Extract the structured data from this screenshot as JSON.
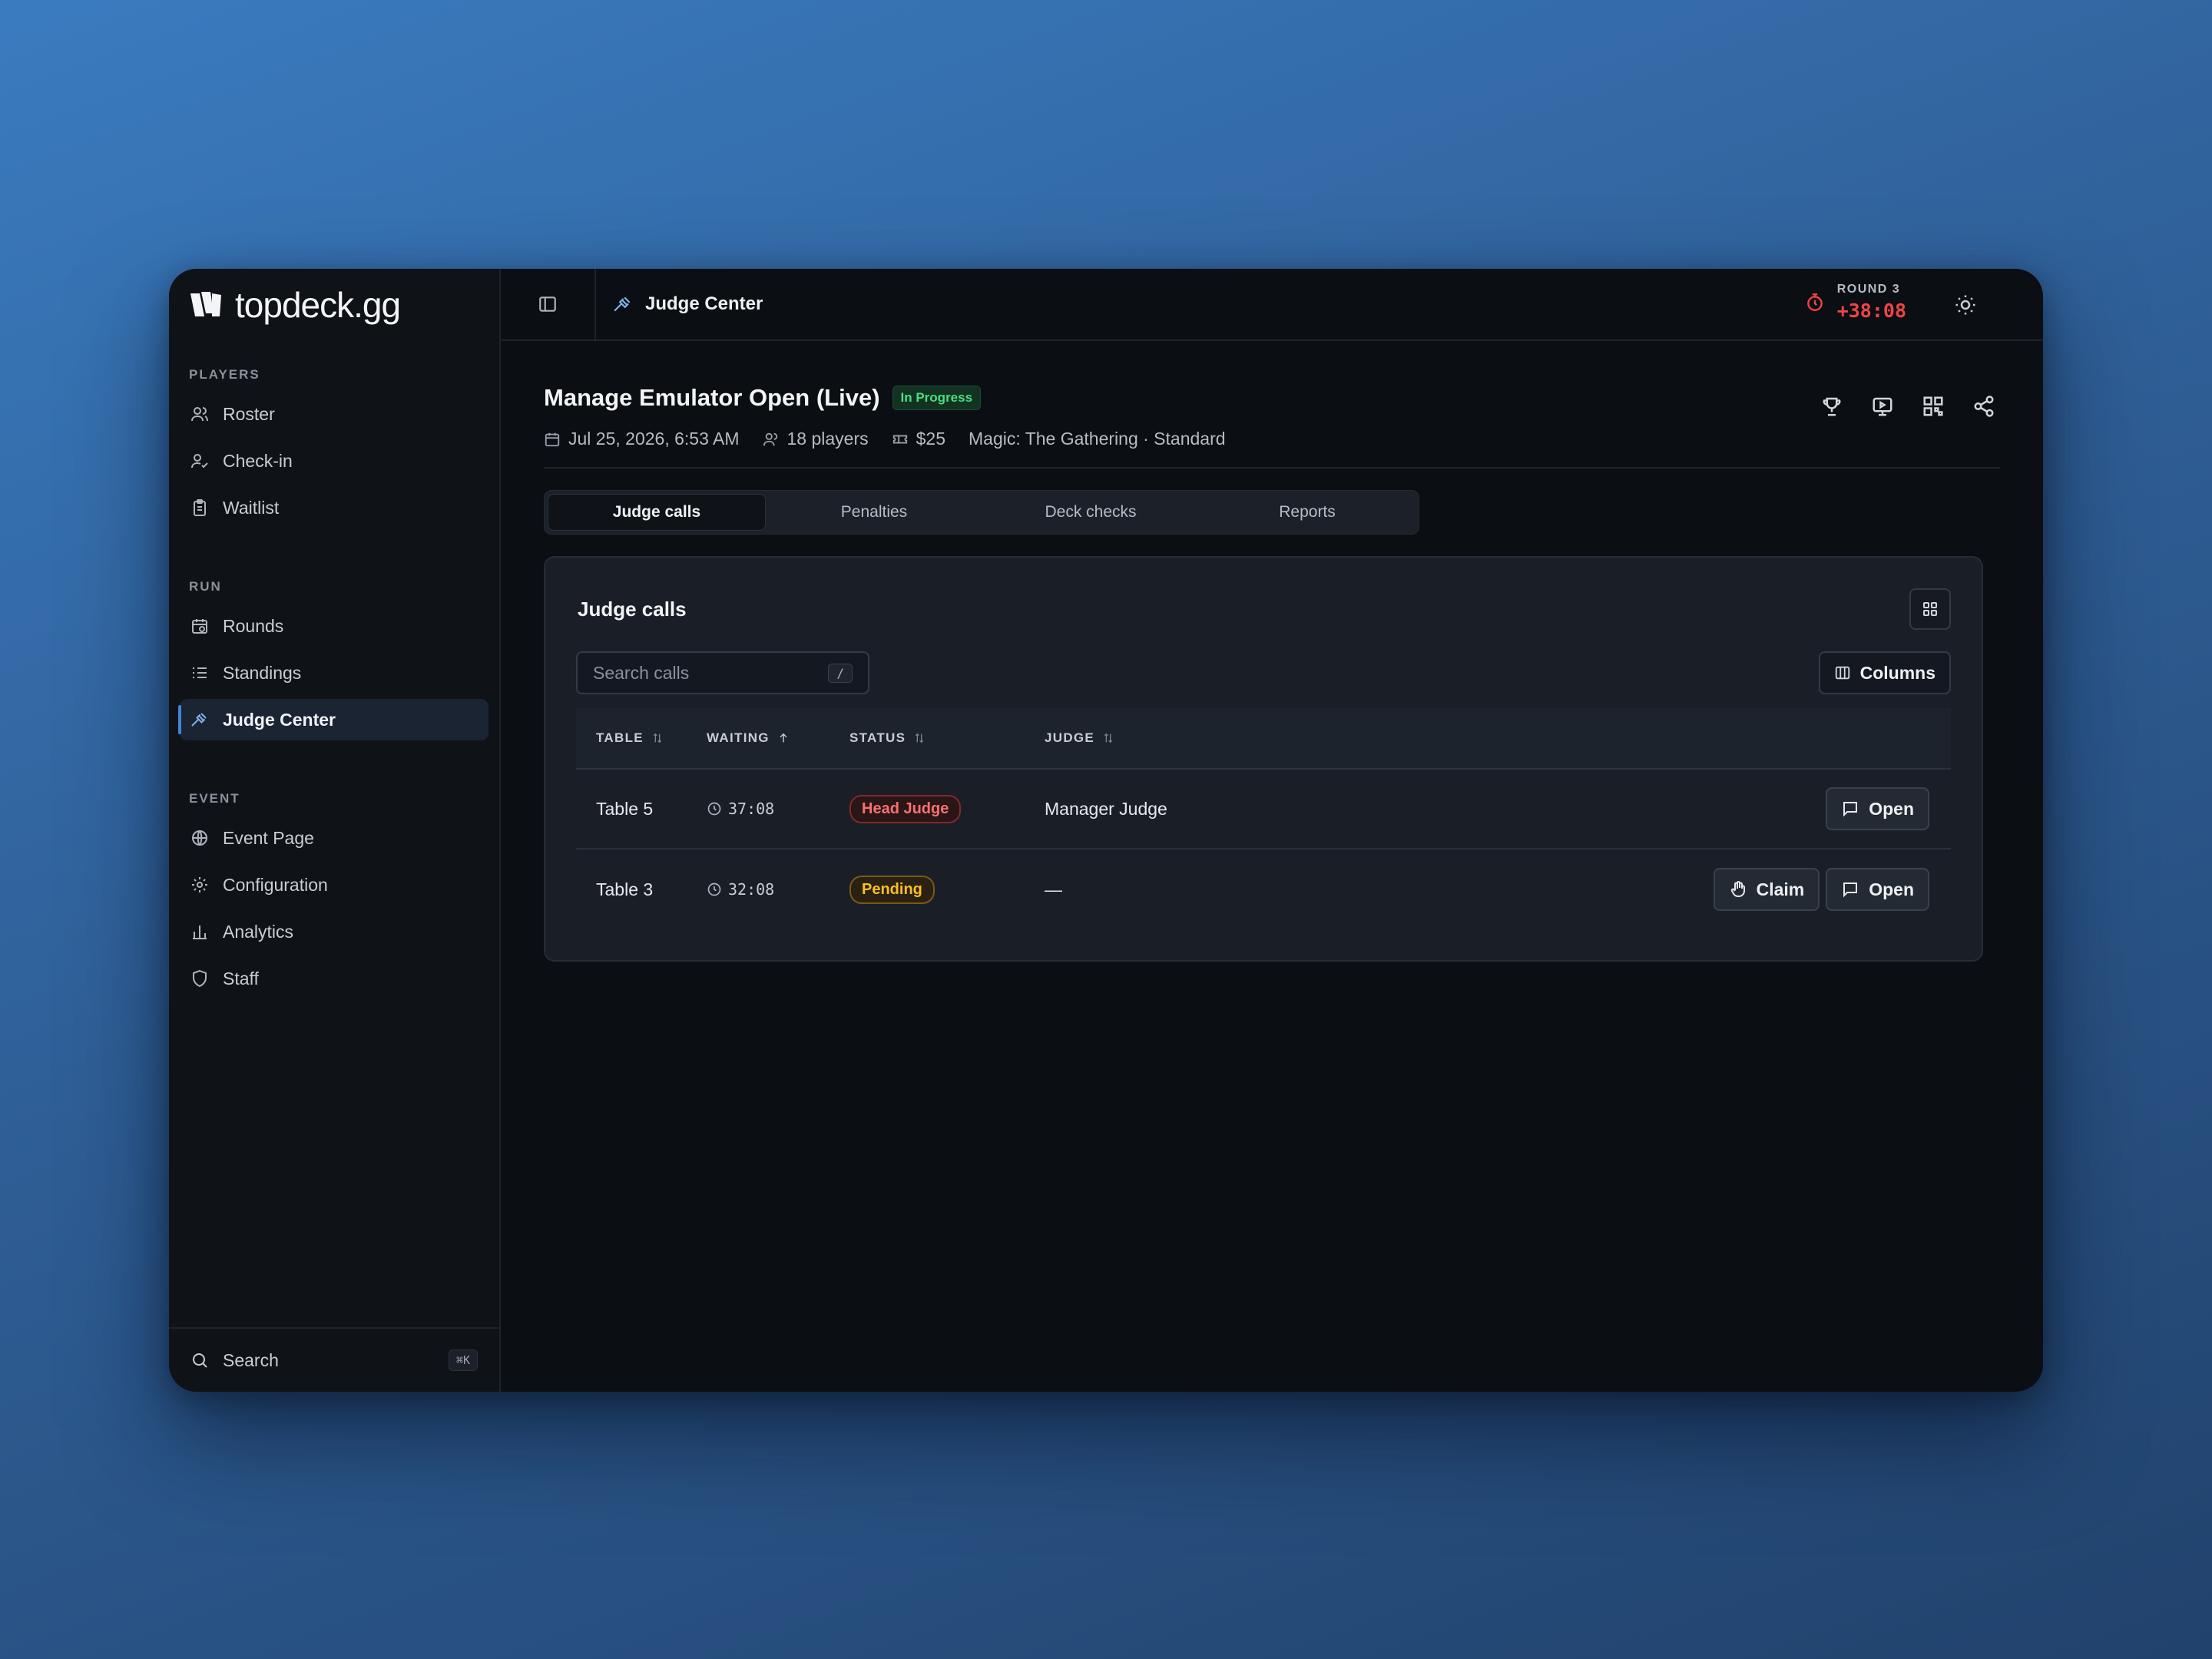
{
  "brand": {
    "name": "topdeck.gg"
  },
  "sidebar": {
    "sections": [
      {
        "label": "PLAYERS",
        "items": [
          {
            "label": "Roster",
            "icon": "users-icon"
          },
          {
            "label": "Check-in",
            "icon": "user-check-icon"
          },
          {
            "label": "Waitlist",
            "icon": "clipboard-icon"
          }
        ]
      },
      {
        "label": "RUN",
        "items": [
          {
            "label": "Rounds",
            "icon": "calendar-clock-icon"
          },
          {
            "label": "Standings",
            "icon": "list-icon"
          },
          {
            "label": "Judge Center",
            "icon": "gavel-icon",
            "active": true
          }
        ]
      },
      {
        "label": "EVENT",
        "items": [
          {
            "label": "Event Page",
            "icon": "globe-icon"
          },
          {
            "label": "Configuration",
            "icon": "gear-icon"
          },
          {
            "label": "Analytics",
            "icon": "bar-chart-icon"
          },
          {
            "label": "Staff",
            "icon": "shield-icon"
          }
        ]
      }
    ],
    "footer": {
      "label": "Search",
      "shortcut": "⌘K"
    }
  },
  "topbar": {
    "breadcrumb": "Judge Center",
    "round_label": "ROUND 3",
    "round_timer": "+38:08",
    "timer_color": "#ef4444"
  },
  "event": {
    "title": "Manage Emulator Open (Live)",
    "status": "In Progress",
    "date": "Jul 25, 2026, 6:53 AM",
    "players": "18 players",
    "fee": "$25",
    "game": "Magic: The Gathering · Standard"
  },
  "tabs": [
    {
      "label": "Judge calls",
      "active": true
    },
    {
      "label": "Penalties"
    },
    {
      "label": "Deck checks"
    },
    {
      "label": "Reports"
    }
  ],
  "card": {
    "title": "Judge calls",
    "search_placeholder": "Search calls",
    "search_shortcut": "/",
    "columns_label": "Columns"
  },
  "table": {
    "headers": {
      "table": "TABLE",
      "waiting": "WAITING",
      "status": "STATUS",
      "judge": "JUDGE"
    },
    "rows": [
      {
        "table": "Table 5",
        "waiting": "37:08",
        "status": "Head Judge",
        "status_kind": "head",
        "judge": "Manager Judge",
        "actions": [
          "Open"
        ]
      },
      {
        "table": "Table 3",
        "waiting": "32:08",
        "status": "Pending",
        "status_kind": "pending",
        "judge": "—",
        "actions": [
          "Claim",
          "Open"
        ]
      }
    ],
    "claim_label": "Claim",
    "open_label": "Open"
  },
  "colors": {
    "accent": "#3f86d8",
    "background": "#0b0e13",
    "success": "#4ade80",
    "danger": "#ef4444",
    "warning": "#fbbf24"
  }
}
